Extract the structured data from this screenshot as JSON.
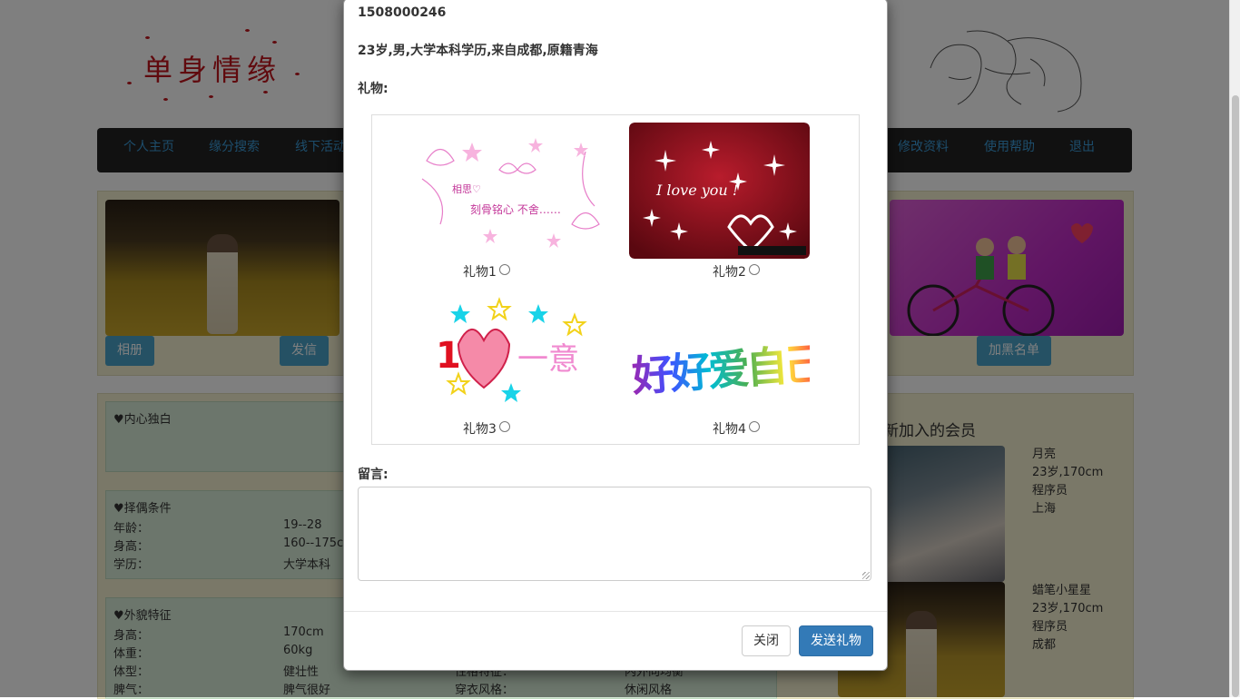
{
  "site": {
    "logo_text": "单身情缘",
    "nav": [
      "个人主页",
      "缘分搜索",
      "线下活动",
      "修改资料",
      "使用帮助",
      "退出"
    ]
  },
  "profile_actions": {
    "album": "相册",
    "message": "发信",
    "blacklist": "加黑名单"
  },
  "sections": {
    "monologue_title": "♥内心独白",
    "criteria": {
      "title": "♥择偶条件",
      "rows": [
        {
          "label": "年龄：",
          "value": "19--28"
        },
        {
          "label": "身高：",
          "value": "160--175c"
        },
        {
          "label": "学历：",
          "value": "大学本科"
        }
      ]
    },
    "appearance": {
      "title": "♥外貌特征",
      "rows": [
        {
          "label": "身高：",
          "value": "170cm"
        },
        {
          "label": "体重：",
          "value": "60kg"
        },
        {
          "label": "体型：",
          "value": "健壮性",
          "label2": "性格特征：",
          "value2": "内外向均衡"
        },
        {
          "label": "脾气：",
          "value": "脾气很好",
          "label2": "穿衣风格：",
          "value2": "休闲风格"
        }
      ]
    }
  },
  "new_members": {
    "title": "新加入的会员",
    "members": [
      {
        "name": "月亮",
        "info": "23岁,170cm",
        "job": "程序员",
        "city": "上海"
      },
      {
        "name": "蜡笔小星星",
        "info": "23岁,170cm",
        "job": "程序员",
        "city": "成都"
      }
    ]
  },
  "modal": {
    "user_id": "1508000246",
    "description": "23岁,男,大学本科学历,来自成都,原籍青海",
    "gift_label": "礼物:",
    "gifts": [
      {
        "label": "礼物1",
        "image": "相思♡ 刻骨铭心 不舍……"
      },
      {
        "label": "礼物2",
        "image": "I love you !"
      },
      {
        "label": "礼物3",
        "image": "1♥一意"
      },
      {
        "label": "礼物4",
        "image": "好好爱自己"
      }
    ],
    "message_label": "留言:",
    "message_value": "",
    "close_button": "关闭",
    "send_button": "发送礼物"
  },
  "colors": {
    "nav_bg": "#222222",
    "nav_link": "#3a9bd8",
    "primary": "#337ab7",
    "info": "#4aa3c9",
    "logo_red": "#c0141c"
  }
}
